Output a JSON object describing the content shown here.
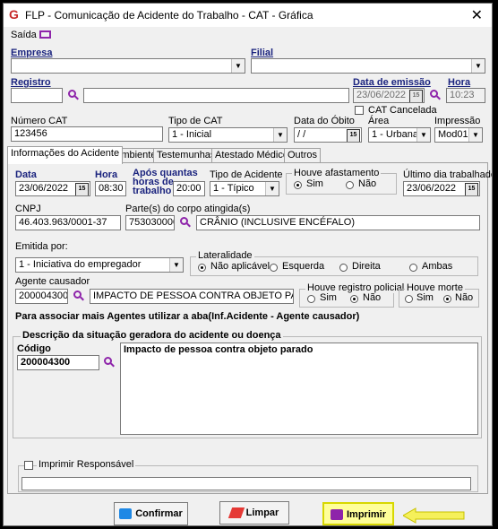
{
  "window": {
    "title": "FLP - Comunicação de Acidente do Trabalho - CAT - Gráfica",
    "close": "✕"
  },
  "menu": {
    "saida": "Saída"
  },
  "header": {
    "empresa_label": "Empresa",
    "filial_label": "Filial",
    "registro_label": "Registro",
    "data_emissao_label": "Data de emissão",
    "data_emissao_value": "23/06/2022",
    "hora_label": "Hora",
    "hora_value": "10:23",
    "cat_cancelada_label": "CAT Cancelada",
    "numero_cat_label": "Número CAT",
    "numero_cat_value": "123456",
    "tipo_cat_label": "Tipo de CAT",
    "tipo_cat_value": "1 - Inicial",
    "data_obito_label": "Data do Óbito",
    "data_obito_value": "/ /",
    "area_label": "Área",
    "area_value": "1 - Urbana",
    "impressao_label": "Impressão",
    "impressao_value": "Mod01"
  },
  "tabs": [
    {
      "label": "Informações do Acidente"
    },
    {
      "label": "Ambiente"
    },
    {
      "label": "Testemunhas"
    },
    {
      "label": "Atestado Médico"
    },
    {
      "label": "Outros"
    }
  ],
  "accident": {
    "data_label": "Data",
    "data_value": "23/06/2022",
    "hora_label": "Hora",
    "hora_value": "08:30",
    "apos_label_1": "Após quantas",
    "apos_label_2": "horas de",
    "apos_label_3": "trabalho",
    "apos_value": "20:00",
    "tipo_label": "Tipo de Acidente",
    "tipo_value": "1 - Típico",
    "afastamento_label": "Houve afastamento",
    "afastamento_sim": "Sim",
    "afastamento_nao": "Não",
    "ultimo_dia_label": "Último dia trabalhado",
    "ultimo_dia_value": "23/06/2022",
    "cnpj_label": "CNPJ",
    "cnpj_value": "46.403.963/0001-37",
    "partes_label": "Parte(s) do corpo atingida(s)",
    "partes_code": "753030000",
    "partes_desc": "CRÂNIO (INCLUSIVE ENCÉFALO)",
    "emitida_label": "Emitida por:",
    "emitida_value": "1 - Iniciativa do empregador",
    "lateralidade_label": "Lateralidade",
    "lat_options": [
      "Não aplicável",
      "Esquerda",
      "Direita",
      "Ambas"
    ],
    "agente_label": "Agente causador",
    "agente_code": "200004300",
    "agente_desc": "IMPACTO DE PESSOA CONTRA OBJETO PARADO..",
    "policial_label": "Houve registro policial",
    "policial_sim": "Sim",
    "policial_nao": "Não",
    "morte_label": "Houve morte",
    "morte_sim": "Sim",
    "morte_nao": "Não",
    "info_text": "Para associar mais Agentes utilizar a aba(Inf.Acidente - Agente causador)",
    "descricao_group": "Descrição da situação geradora do acidente ou doença",
    "codigo_label": "Código",
    "codigo_value": "200004300",
    "descricao_text": "Impacto de pessoa contra objeto parado",
    "imprimir_resp_label": "Imprimir Responsável"
  },
  "buttons": {
    "confirmar": "Confirmar",
    "limpar": "Limpar",
    "imprimir": "Imprimir"
  },
  "colors": {
    "label_blue": "#1a237e",
    "icon_purple": "#8e24aa",
    "highlight_yellow": "#ffff33",
    "arrow_yellow": "#f5f05a"
  }
}
